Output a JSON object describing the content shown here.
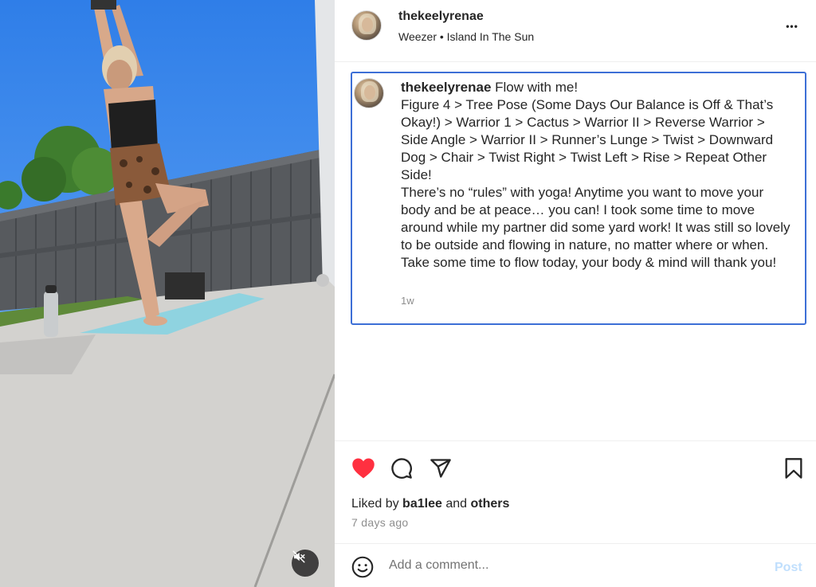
{
  "media": {
    "mute_icon": "speaker-muted-icon"
  },
  "post": {
    "author": "thekeelyrenae",
    "audio": "Weezer • Island In The Sun",
    "more_icon": "more-horizontal-icon",
    "more_label": "•••",
    "caption": {
      "author": "thekeelyrenae",
      "text": "Flow with me!\nFigure 4 > Tree Pose (Some Days Our Balance is Off & That’s Okay!) > Warrior 1 > Cactus > Warrior II > Reverse Warrior > Side Angle > Warrior II > Runner’s Lunge > Twist > Downward Dog > Chair > Twist Right > Twist Left > Rise > Repeat Other Side!\nThere’s no “rules” with yoga! Anytime you want to move your body and be at peace… you can! I took some time to move around while my partner did some yard work! It was still so lovely to be outside and flowing in nature, no matter where or when. Take some time to flow today, your body & mind will thank you!",
      "time": "1w"
    },
    "actions": {
      "like_icon": "heart-filled-icon",
      "comment_icon": "comment-icon",
      "share_icon": "share-icon",
      "save_icon": "bookmark-icon",
      "like_color": "#ff3040"
    },
    "likes": {
      "prefix": "Liked by",
      "user": "ba1lee",
      "conj": "and",
      "others": "others"
    },
    "date": "7 days ago",
    "comment": {
      "emoji_icon": "emoji-icon",
      "placeholder": "Add a comment...",
      "post_label": "Post"
    }
  }
}
